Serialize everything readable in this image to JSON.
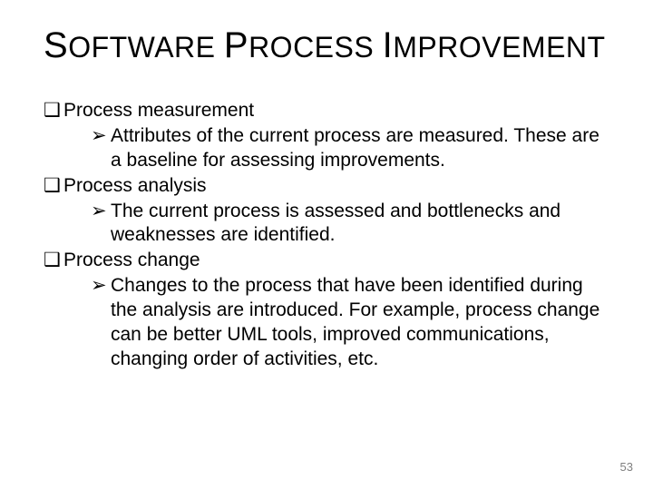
{
  "title": {
    "w1_cap": "S",
    "w1_rest": "OFTWARE",
    "w2_cap": "P",
    "w2_rest": "ROCESS",
    "w3_cap": "I",
    "w3_rest": "MPROVEMENT"
  },
  "bullets": {
    "square": "❑",
    "arrow": "➢"
  },
  "items": [
    {
      "label": "Process measurement",
      "sub": "Attributes of the current process are measured. These are a baseline for assessing improvements."
    },
    {
      "label": "Process analysis",
      "sub": "The current process is assessed and bottlenecks and weaknesses are identified."
    },
    {
      "label": "Process change",
      "sub": "Changes to the process that have been identified during the analysis are introduced. For example, process change can be better UML tools, improved communications, changing order of activities, etc."
    }
  ],
  "page_number": "53"
}
